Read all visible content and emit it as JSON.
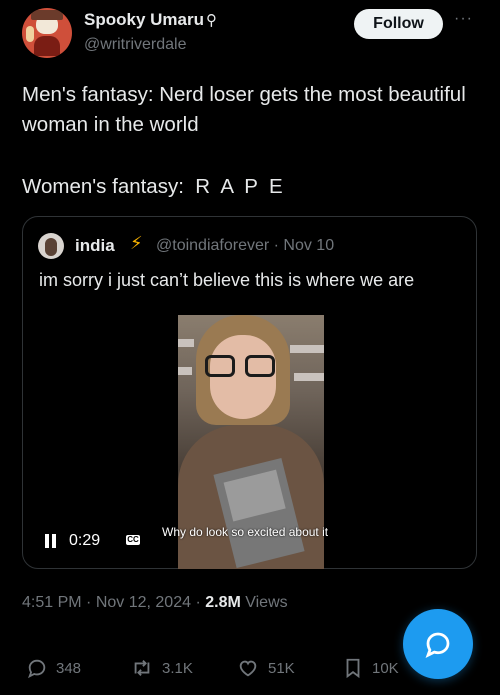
{
  "author": {
    "name": "Spooky Umaru",
    "name_glyph": "⚲",
    "handle": "@writriverdale",
    "follow_label": "Follow",
    "more_label": "···"
  },
  "tweet": {
    "line1": "Men's fantasy: Nerd loser gets the most beautiful woman in the world",
    "line2": "Women's fantasy:  R  A  P  E"
  },
  "quote": {
    "name": "india",
    "badge": "⚡",
    "handle_date": "@toindiaforever · Nov 10",
    "text": "im sorry i just can’t believe this is where we are",
    "video": {
      "caption": "Why do look so excited about it",
      "time": "0:29",
      "cc_label": "CC"
    }
  },
  "meta": {
    "time": "4:51 PM",
    "date": " · Nov 12, 2024 · ",
    "views_count": "2.8M",
    "views_label": " Views"
  },
  "actions": {
    "replies": "348",
    "reposts": "3.1K",
    "likes": "51K",
    "bookmarks": "10K"
  },
  "colors": {
    "accent": "#1d9bf0",
    "background": "#000000",
    "muted": "#71767b",
    "text": "#e7e9ea"
  }
}
